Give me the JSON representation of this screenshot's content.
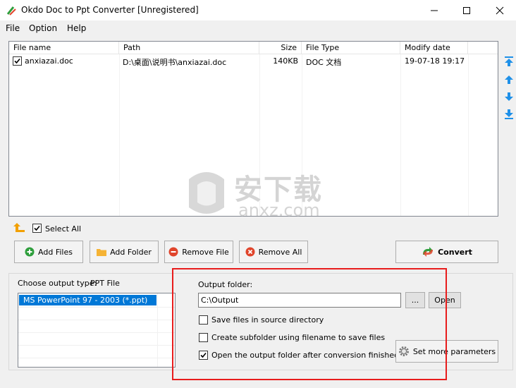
{
  "window": {
    "title": "Okdo Doc to Ppt Converter [Unregistered]",
    "minimize": "—",
    "maximize": "☐",
    "close": "✕"
  },
  "menu": {
    "file": "File",
    "option": "Option",
    "help": "Help"
  },
  "file_table": {
    "headers": {
      "name": "File name",
      "path": "Path",
      "size": "Size",
      "type": "File Type",
      "date": "Modify date"
    },
    "rows": [
      {
        "checked": true,
        "name": "anxiazai.doc",
        "path": "D:\\桌面\\说明书\\anxiazai.doc",
        "size": "140KB",
        "type": "DOC 文档",
        "date": "19-07-18 19:17"
      }
    ]
  },
  "select_all": {
    "label": "Select All",
    "checked": true
  },
  "buttons": {
    "add_files": "Add Files",
    "add_folder": "Add Folder",
    "remove_file": "Remove File",
    "remove_all": "Remove All",
    "convert": "Convert"
  },
  "output_type": {
    "label": "Choose output type:",
    "value": "PPT File",
    "options": [
      "MS PowerPoint 97 - 2003 (*.ppt)"
    ]
  },
  "output": {
    "folder_label": "Output folder:",
    "folder_value": "C:\\Output",
    "browse": "...",
    "open": "Open",
    "save_in_source": {
      "label": "Save files in source directory",
      "checked": false
    },
    "create_subfolder": {
      "label": "Create subfolder using filename to save files",
      "checked": false
    },
    "open_after": {
      "label": "Open the output folder after conversion finished",
      "checked": true
    },
    "set_params": "Set more parameters"
  },
  "watermark": {
    "cn": "安下载",
    "en": "anxz.com"
  },
  "colors": {
    "selection": "#0078d7",
    "highlight_box": "#e81c1c",
    "accent_green": "#2e9e3c",
    "accent_red": "#e0442b",
    "accent_blue": "#1e90e8"
  }
}
